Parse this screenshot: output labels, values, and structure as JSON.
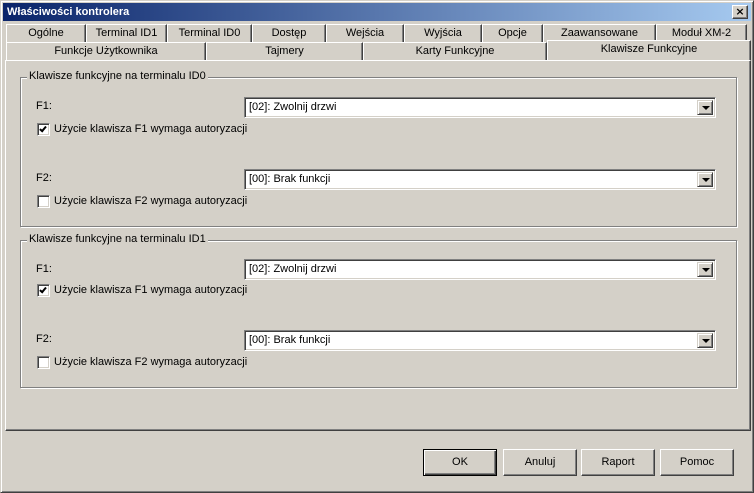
{
  "window": {
    "title": "Właściwości kontrolera",
    "close_glyph": "×"
  },
  "tabs_row1": [
    {
      "label": "Ogólne"
    },
    {
      "label": "Terminal ID1"
    },
    {
      "label": "Terminal ID0"
    },
    {
      "label": "Dostęp"
    },
    {
      "label": "Wejścia"
    },
    {
      "label": "Wyjścia"
    },
    {
      "label": "Opcje"
    },
    {
      "label": "Zaawansowane"
    },
    {
      "label": "Moduł XM-2"
    }
  ],
  "tabs_row2": [
    {
      "label": "Funkcje Użytkownika"
    },
    {
      "label": "Tajmery"
    },
    {
      "label": "Karty Funkcyjne"
    },
    {
      "label": "Klawisze Funkcyjne",
      "active": true
    }
  ],
  "groups": [
    {
      "title": "Klawisze funkcyjne na terminalu ID0",
      "f1": {
        "label": "F1:",
        "value": "[02]: Zwolnij drzwi",
        "checkbox_label": "Użycie klawisza F1 wymaga autoryzacji",
        "checked": true
      },
      "f2": {
        "label": "F2:",
        "value": "[00]: Brak funkcji",
        "checkbox_label": "Użycie klawisza F2 wymaga autoryzacji",
        "checked": false
      }
    },
    {
      "title": "Klawisze funkcyjne na terminalu ID1",
      "f1": {
        "label": "F1:",
        "value": "[02]: Zwolnij drzwi",
        "checkbox_label": "Użycie klawisza F1 wymaga autoryzacji",
        "checked": true
      },
      "f2": {
        "label": "F2:",
        "value": "[00]: Brak funkcji",
        "checkbox_label": "Użycie klawisza F2 wymaga autoryzacji",
        "checked": false
      }
    }
  ],
  "buttons": {
    "ok": "OK",
    "cancel": "Anuluj",
    "report": "Raport",
    "help": "Pomoc"
  },
  "colors": {
    "titlebar_start": "#0a246a",
    "titlebar_end": "#a6caf0",
    "face": "#d4d0c8"
  }
}
